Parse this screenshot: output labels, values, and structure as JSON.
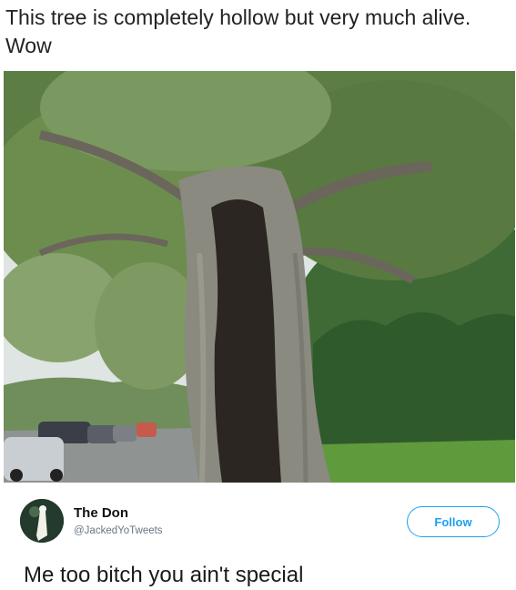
{
  "post": {
    "caption": "This tree is completely hollow but very much alive. Wow"
  },
  "tweet": {
    "display_name": "The Don",
    "handle": "@JackedYoTweets",
    "follow_label": "Follow",
    "text": "Me too bitch you ain't special"
  },
  "icons": {
    "avatar": "avatar-image"
  },
  "colors": {
    "accent": "#1da1f2",
    "handle": "#657786"
  }
}
